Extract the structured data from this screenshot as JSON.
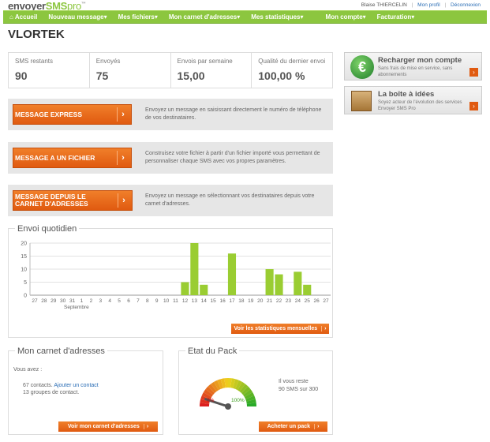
{
  "header": {
    "user_name": "Blaise THIERCELIN",
    "profile_link": "Mon profil",
    "logout_link": "Déconnexion"
  },
  "nav": [
    {
      "label": "Accueil"
    },
    {
      "label": "Nouveau message▾"
    },
    {
      "label": "Mes fichiers▾"
    },
    {
      "label": "Mon carnet d'adresses▾"
    },
    {
      "label": "Mes statistiques▾"
    },
    {
      "label": "Mon compte▾"
    },
    {
      "label": "Facturation▾"
    }
  ],
  "page_title": "VLORTEK",
  "stats": [
    {
      "label": "SMS restants",
      "value": "90"
    },
    {
      "label": "Envoyés",
      "value": "75"
    },
    {
      "label": "Envois par semaine",
      "value": "15,00"
    },
    {
      "label": "Qualité du dernier envoi",
      "value": "100,00 %"
    }
  ],
  "actions": [
    {
      "label": "MESSAGE EXPRESS",
      "desc": "Envoyez un message en saisissant directement le numéro de téléphone de vos destinataires."
    },
    {
      "label": "MESSAGE A UN FICHIER",
      "desc": "Construisez votre fichier à partir d'un fichier importé vous permettant de personnaliser chaque SMS avec vos propres paramètres."
    },
    {
      "label": "MESSAGE DEPUIS LE CARNET D'ADRESSES",
      "desc": "Envoyez un message en sélectionnant vos destinataires depuis votre carnet d'adresses."
    }
  ],
  "chart_panel": {
    "title": "Envoi quotidien",
    "month_label": "Septembre",
    "link": "Voir les statistiques mensuelles"
  },
  "chart_data": {
    "type": "bar",
    "categories": [
      "27",
      "28",
      "29",
      "30",
      "31",
      "1",
      "2",
      "3",
      "4",
      "5",
      "6",
      "7",
      "8",
      "9",
      "10",
      "11",
      "12",
      "13",
      "14",
      "15",
      "16",
      "17",
      "18",
      "19",
      "20",
      "21",
      "22",
      "23",
      "24",
      "25",
      "26",
      "27"
    ],
    "values": [
      0,
      0,
      0,
      0,
      0,
      0,
      0,
      0,
      0,
      0,
      0,
      0,
      0,
      0,
      0,
      0,
      5,
      20,
      4,
      0,
      0,
      16,
      0,
      0,
      0,
      10,
      8,
      0,
      9,
      4,
      0,
      0
    ],
    "yticks": [
      0,
      5,
      10,
      15,
      20
    ],
    "ylim": [
      0,
      20
    ],
    "color": "#9acd32",
    "grid": true
  },
  "addressbook": {
    "title": "Mon carnet d'adresses",
    "you_have": "Vous avez :",
    "contacts": "67 contacts.",
    "add_contact": "Ajouter un contact",
    "groups": "13 groupes de contact.",
    "button": "Voir mon carnet d'adresses"
  },
  "pack": {
    "title": "Etat du Pack",
    "gauge_min": "0%",
    "gauge_max": "100%",
    "level": 0.1,
    "remaining_line1": "Il vous reste",
    "remaining_line2": "90 SMS sur 300",
    "button": "Acheter un pack"
  },
  "side": {
    "recharge_title": "Recharger mon compte",
    "recharge_sub": "Sans frais de mise en service, sans abonnements",
    "ideas_title": "La boîte à idées",
    "ideas_sub": "Soyez acteur de l'évolution des services Envoyer SMS Pro"
  },
  "colors": {
    "accent_green": "#8cc63f",
    "accent_orange": "#e8661a"
  }
}
